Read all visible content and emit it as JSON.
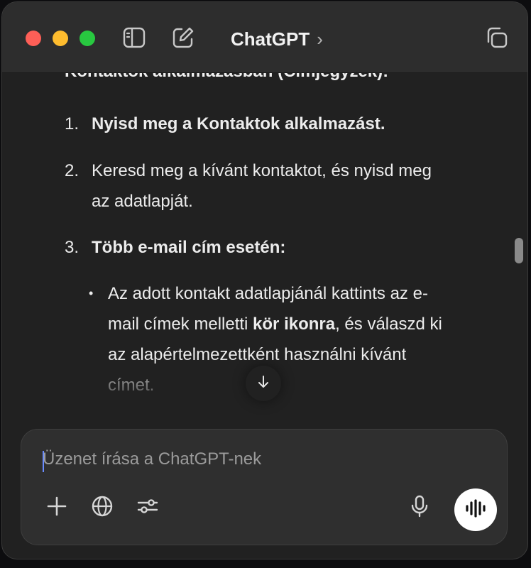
{
  "titlebar": {
    "model_name": "ChatGPT",
    "model_chevron": "›"
  },
  "message": {
    "cut_heading": "Kontaktok alkalmazásban (Címjegyzék):",
    "steps": [
      {
        "number": "1.",
        "text": "Nyisd meg a Kontaktok alkalmazást."
      },
      {
        "number": "2.",
        "text": "Keresd meg a kívánt kontaktot, és nyisd meg az adatlapját."
      },
      {
        "number": "3.",
        "text": "Több e-mail cím esetén:"
      }
    ],
    "bullet": {
      "marker": "•",
      "before": "Az adott kontakt adatlapjánál kattints az e-mail címek melletti ",
      "bold": "kör ikonra",
      "after": ", és válaszd ki az alapértelmezettként használni kívánt címet."
    }
  },
  "composer": {
    "placeholder": "Üzenet írása a ChatGPT-nek"
  },
  "icons": {
    "sidebar": "sidebar-toggle-icon",
    "compose": "new-chat-icon",
    "new_window": "new-window-icon",
    "scroll": "arrow-down-icon",
    "plus": "plus-icon",
    "globe": "globe-icon",
    "tools": "sliders-icon",
    "mic": "microphone-icon",
    "voice": "voice-waveform-icon"
  },
  "colors": {
    "window_bg": "#212121",
    "titlebar_bg": "#2d2d2d",
    "composer_bg": "#2f2f2f",
    "traffic_red": "#fe5f57",
    "traffic_yellow": "#febc2e",
    "traffic_green": "#28c840"
  }
}
